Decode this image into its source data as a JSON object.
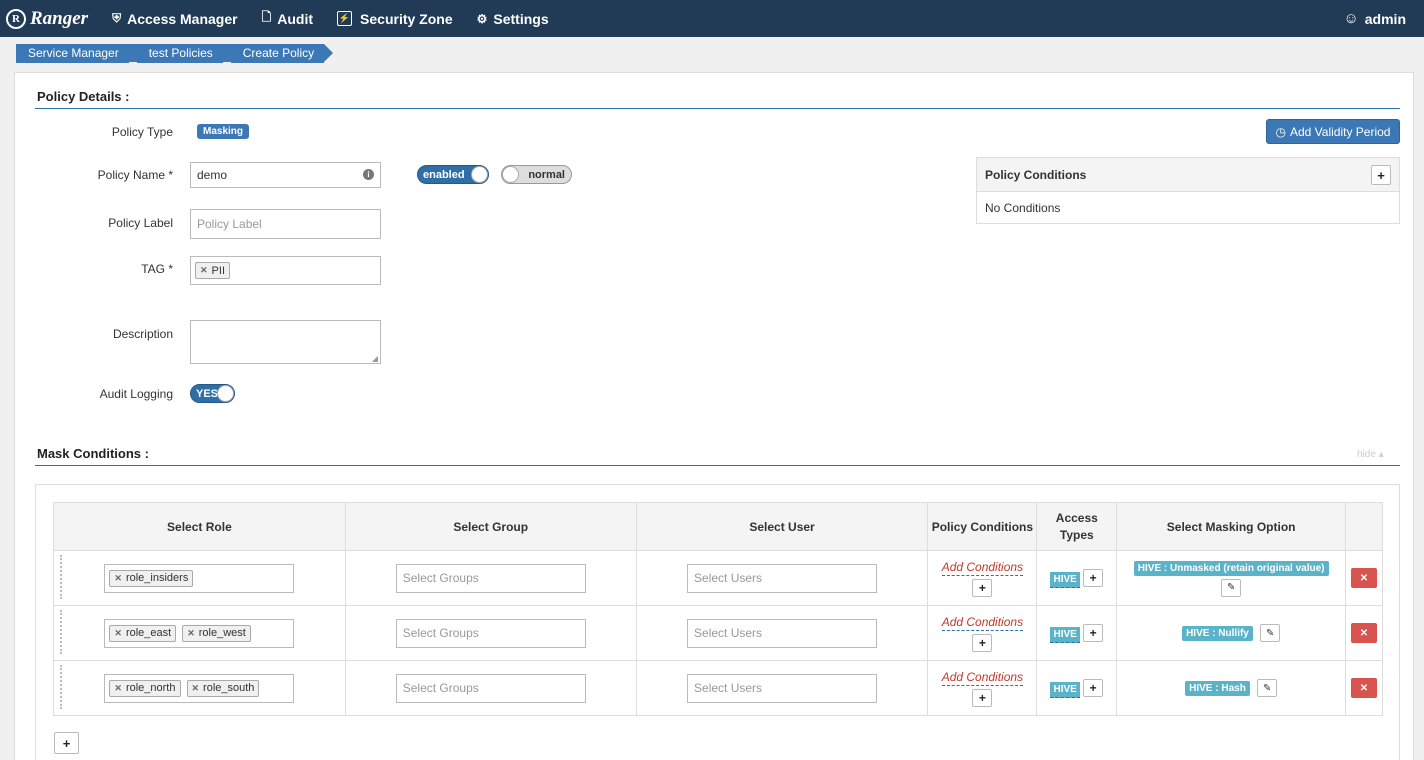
{
  "navbar": {
    "brand": "Ranger",
    "items": [
      {
        "label": "Access Manager",
        "icon": "shield-icon"
      },
      {
        "label": "Audit",
        "icon": "file-icon"
      },
      {
        "label": "Security Zone",
        "icon": "bolt-icon"
      },
      {
        "label": "Settings",
        "icon": "gear-icon"
      }
    ],
    "user": "admin"
  },
  "breadcrumb": [
    "Service Manager",
    "test Policies",
    "Create Policy"
  ],
  "policy_details": {
    "title": "Policy Details :",
    "policy_type_label": "Policy Type",
    "policy_type_value": "Masking",
    "policy_name_label": "Policy Name *",
    "policy_name_value": "demo",
    "enabled_toggle": "enabled",
    "normal_toggle": "normal",
    "policy_label_label": "Policy Label",
    "policy_label_placeholder": "Policy Label",
    "tag_label": "TAG *",
    "tag_value": "PII",
    "description_label": "Description",
    "audit_logging_label": "Audit Logging",
    "audit_logging_value": "YES",
    "add_validity_period": "Add Validity Period"
  },
  "policy_conditions": {
    "title": "Policy Conditions",
    "empty": "No Conditions"
  },
  "mask_conditions": {
    "title": "Mask Conditions :",
    "hide": "hide",
    "columns": [
      "Select Role",
      "Select Group",
      "Select User",
      "Policy Conditions",
      "Access Types",
      "Select Masking Option"
    ],
    "group_placeholder": "Select Groups",
    "user_placeholder": "Select Users",
    "add_conditions": "Add Conditions",
    "rows": [
      {
        "roles": [
          "role_insiders"
        ],
        "access": "HIVE",
        "mask": "HIVE : Unmasked (retain original value)"
      },
      {
        "roles": [
          "role_east",
          "role_west"
        ],
        "access": "HIVE",
        "mask": "HIVE : Nullify"
      },
      {
        "roles": [
          "role_north",
          "role_south"
        ],
        "access": "HIVE",
        "mask": "HIVE : Hash"
      }
    ]
  }
}
